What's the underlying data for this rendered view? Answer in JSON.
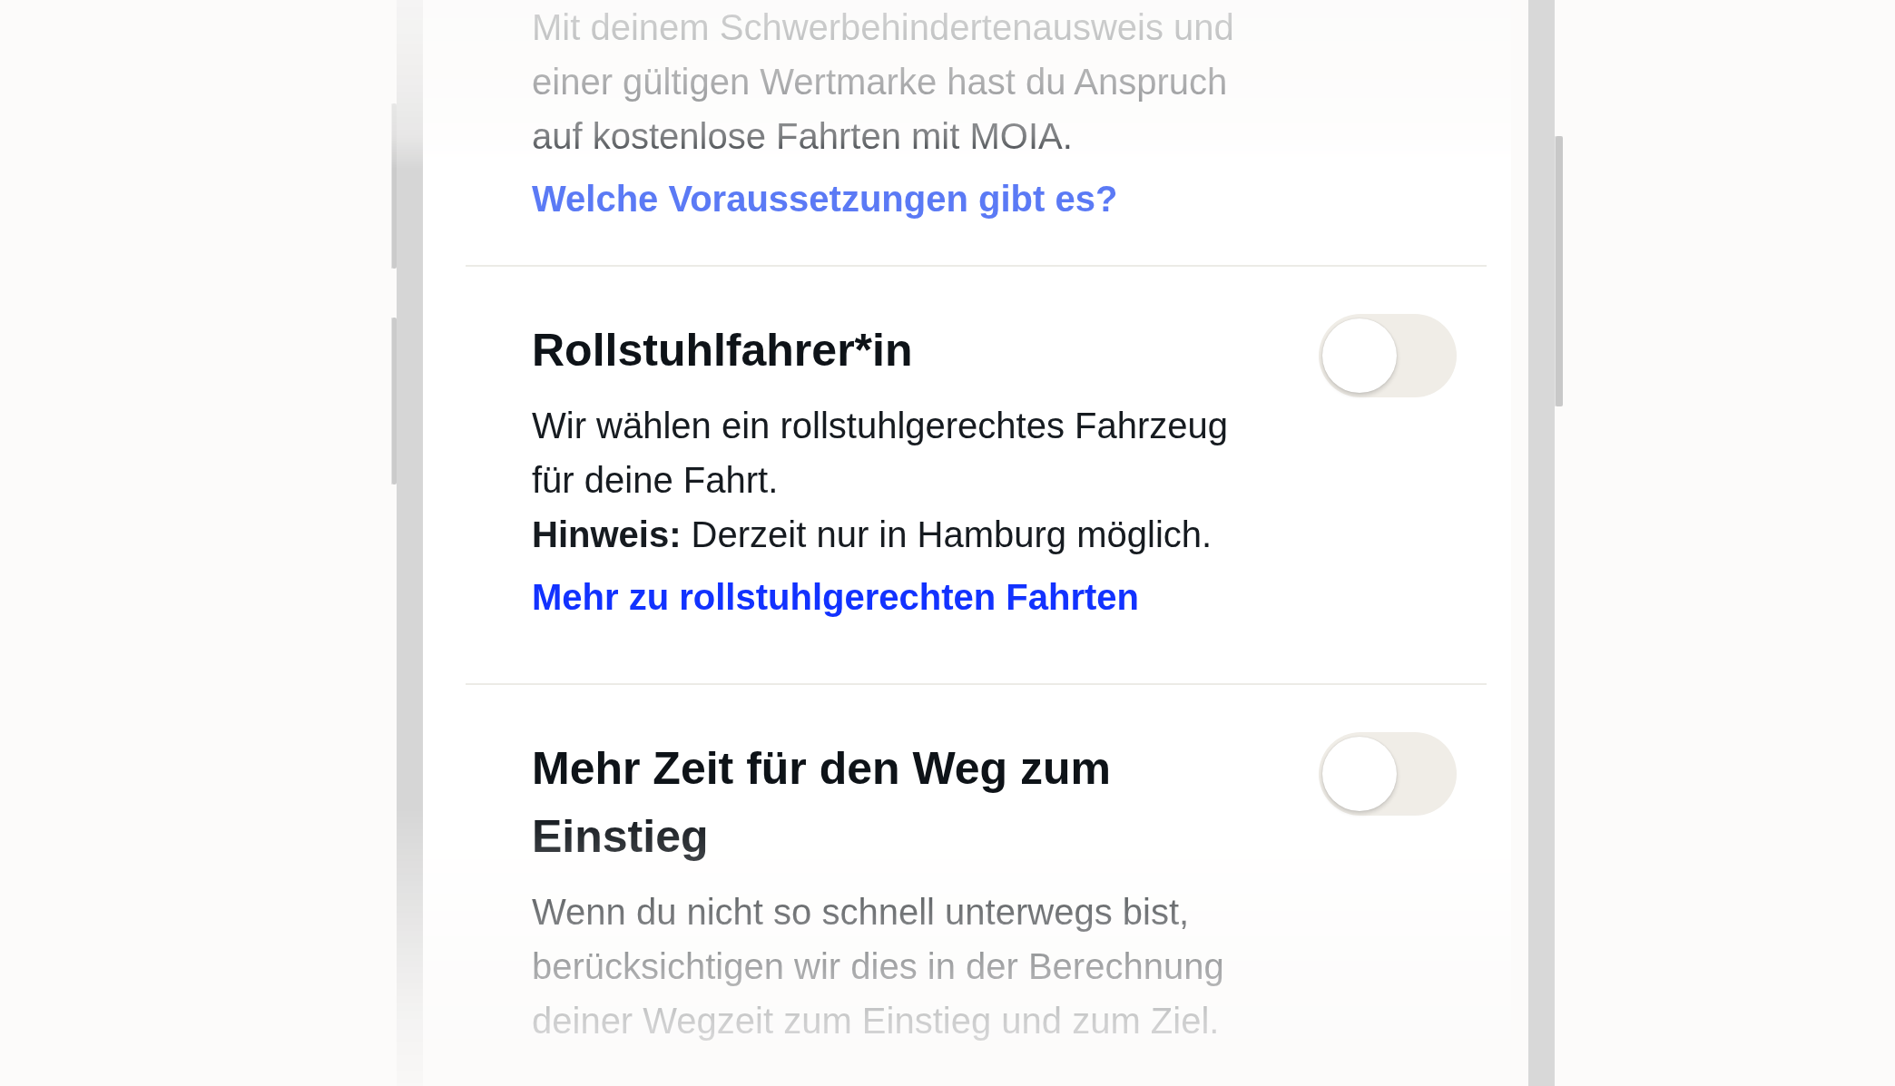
{
  "sections": [
    {
      "description": "Mit deinem Schwerbehindertenausweis und einer gültigen Wertmarke hast du Anspruch auf kostenlose Fahrten mit MOIA.",
      "link": "Welche Voraussetzungen gibt es?"
    },
    {
      "title": "Rollstuhlfahrer*in",
      "toggle": {
        "on": false
      },
      "description": "Wir wählen ein rollstuhlgerechtes Fahrzeug für deine Fahrt.",
      "note": "**Hinweis:** Derzeit nur in Hamburg möglich.",
      "link": "Mehr zu rollstuhlgerechten Fahrten"
    },
    {
      "title": "Mehr Zeit für den Weg zum Einstieg",
      "toggle": {
        "on": false
      },
      "description": "Wenn du nicht so schnell unterwegs bist, berücksichtigen wir dies in der Berechnung deiner Wegzeit zum Einstieg und zum Ziel."
    }
  ]
}
